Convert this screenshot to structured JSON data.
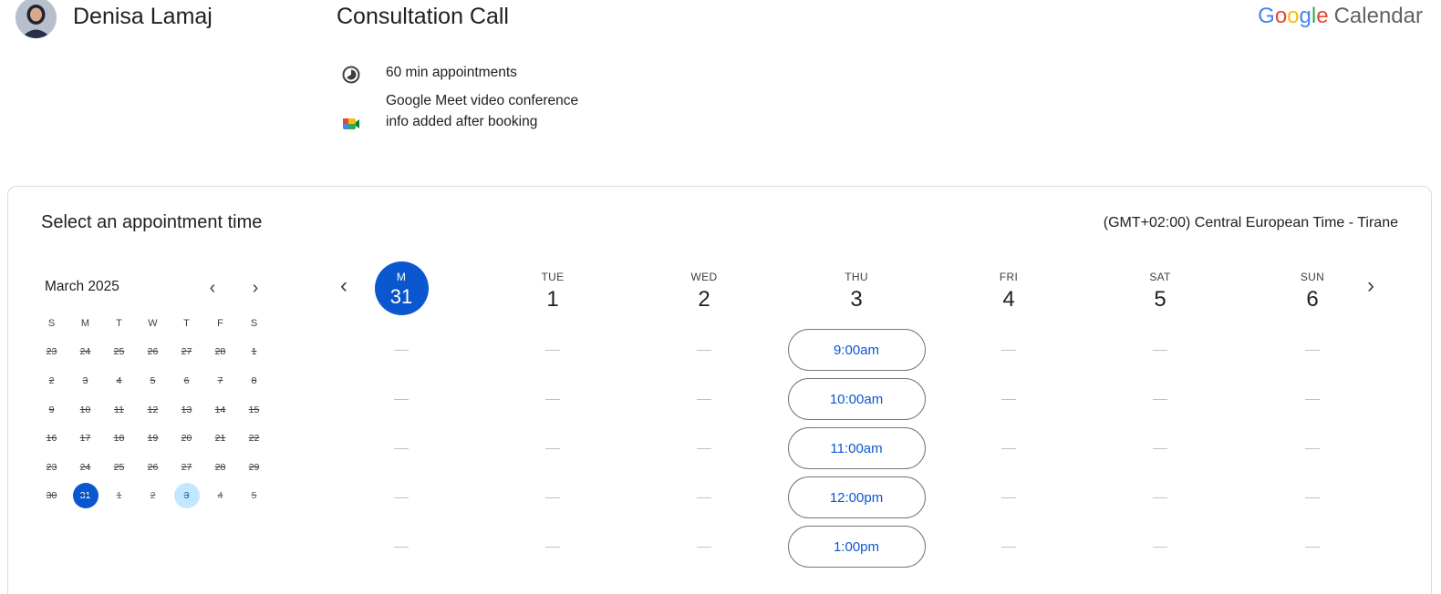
{
  "host": {
    "name": "Denisa Lamaj"
  },
  "event": {
    "title": "Consultation Call"
  },
  "brand": {
    "google_letters": [
      {
        "char": "G",
        "color": "#4285F4"
      },
      {
        "char": "o",
        "color": "#EA4335"
      },
      {
        "char": "o",
        "color": "#FBBC05"
      },
      {
        "char": "g",
        "color": "#4285F4"
      },
      {
        "char": "l",
        "color": "#34A853"
      },
      {
        "char": "e",
        "color": "#EA4335"
      }
    ],
    "product": "Calendar"
  },
  "details": {
    "duration": {
      "icon": "clock-icon",
      "text": "60 min appointments"
    },
    "meet": {
      "icon": "google-meet-icon",
      "text": "Google Meet video conference info added after booking"
    }
  },
  "panel": {
    "title": "Select an appointment time",
    "timezone": "(GMT+02:00) Central European Time - Tirane"
  },
  "mini_calendar": {
    "month": "March 2025",
    "weekday_headers": [
      "S",
      "M",
      "T",
      "W",
      "T",
      "F",
      "S"
    ],
    "weeks": [
      [
        "23",
        "24",
        "25",
        "26",
        "27",
        "28",
        "1"
      ],
      [
        "2",
        "3",
        "4",
        "5",
        "6",
        "7",
        "8"
      ],
      [
        "9",
        "10",
        "11",
        "12",
        "13",
        "14",
        "15"
      ],
      [
        "16",
        "17",
        "18",
        "19",
        "20",
        "21",
        "22"
      ],
      [
        "23",
        "24",
        "25",
        "26",
        "27",
        "28",
        "29"
      ],
      [
        "30",
        "31",
        "1",
        "2",
        "3",
        "4",
        "5"
      ]
    ],
    "selected_day": "31",
    "available_days": [
      "3"
    ]
  },
  "week": {
    "days": [
      {
        "dow": "M",
        "num": "31",
        "today": true
      },
      {
        "dow": "TUE",
        "num": "1"
      },
      {
        "dow": "WED",
        "num": "2"
      },
      {
        "dow": "THU",
        "num": "3"
      },
      {
        "dow": "FRI",
        "num": "4"
      },
      {
        "dow": "SAT",
        "num": "5"
      },
      {
        "dow": "SUN",
        "num": "6"
      }
    ],
    "available_day": "THU",
    "slots": [
      "9:00am",
      "10:00am",
      "11:00am",
      "12:00pm",
      "1:00pm"
    ]
  }
}
